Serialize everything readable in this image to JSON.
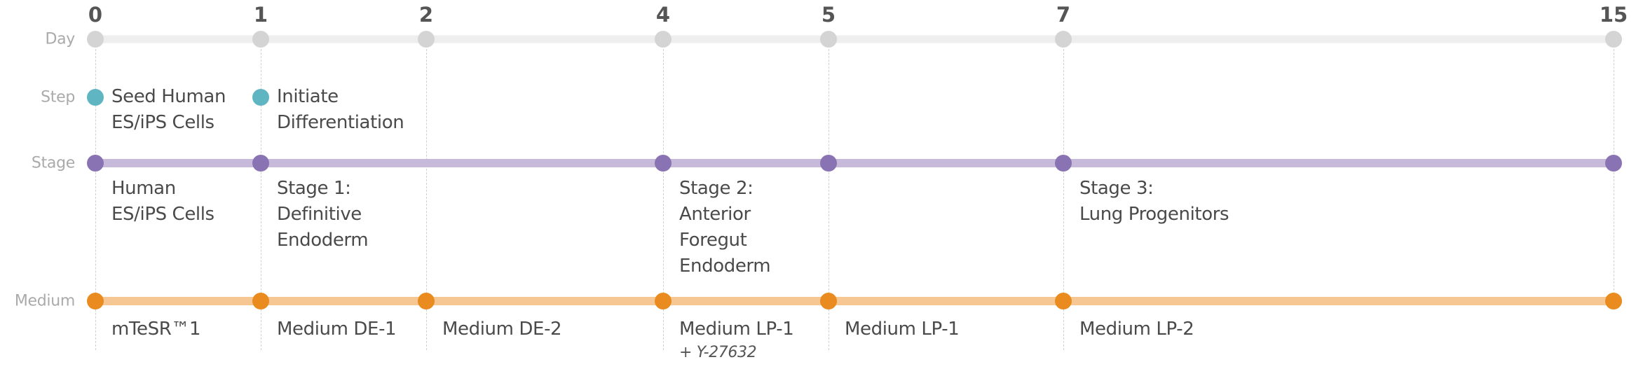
{
  "days": [
    0,
    1,
    2,
    4,
    5,
    7,
    15
  ],
  "day_labels": [
    "0",
    "1",
    "2",
    "4",
    "5",
    "7",
    "15"
  ],
  "rows": {
    "day": {
      "label": "Day",
      "dot_color": "#d4d4d4",
      "line_color": "#eeeeee"
    },
    "step": {
      "label": "Step",
      "dot_color": "#5fb5c1"
    },
    "stage": {
      "label": "Stage",
      "dot_color": "#8a73b3",
      "line_color": "#c7b9da"
    },
    "medium": {
      "label": "Medium",
      "dot_color": "#e98b1e",
      "line_color": "#f6c792"
    }
  },
  "steps": [
    {
      "day": 0,
      "lines": [
        "Seed Human",
        "ES/iPS Cells"
      ]
    },
    {
      "day": 1,
      "lines": [
        "Initiate",
        "Differentiation"
      ]
    }
  ],
  "stage_points": [
    0,
    1,
    4,
    5,
    7,
    15
  ],
  "stages": [
    {
      "day": 0,
      "lines": [
        "Human",
        "ES/iPS Cells"
      ]
    },
    {
      "day": 1,
      "lines": [
        "Stage 1:",
        "Definitive",
        "Endoderm"
      ]
    },
    {
      "day": 4,
      "lines": [
        "Stage 2:",
        "Anterior",
        "Foregut",
        "Endoderm"
      ]
    },
    {
      "day": 7,
      "lines": [
        "Stage 3:",
        "Lung Progenitors"
      ]
    }
  ],
  "medium_points": [
    0,
    1,
    2,
    4,
    5,
    7,
    15
  ],
  "media": [
    {
      "day": 0,
      "label": "mTeSR™1"
    },
    {
      "day": 1,
      "label": "Medium DE-1"
    },
    {
      "day": 2,
      "label": "Medium DE-2"
    },
    {
      "day": 4,
      "label": "Medium LP-1",
      "note": "+ Y-27632"
    },
    {
      "day": 5,
      "label": "Medium LP-1"
    },
    {
      "day": 7,
      "label": "Medium LP-2"
    }
  ]
}
